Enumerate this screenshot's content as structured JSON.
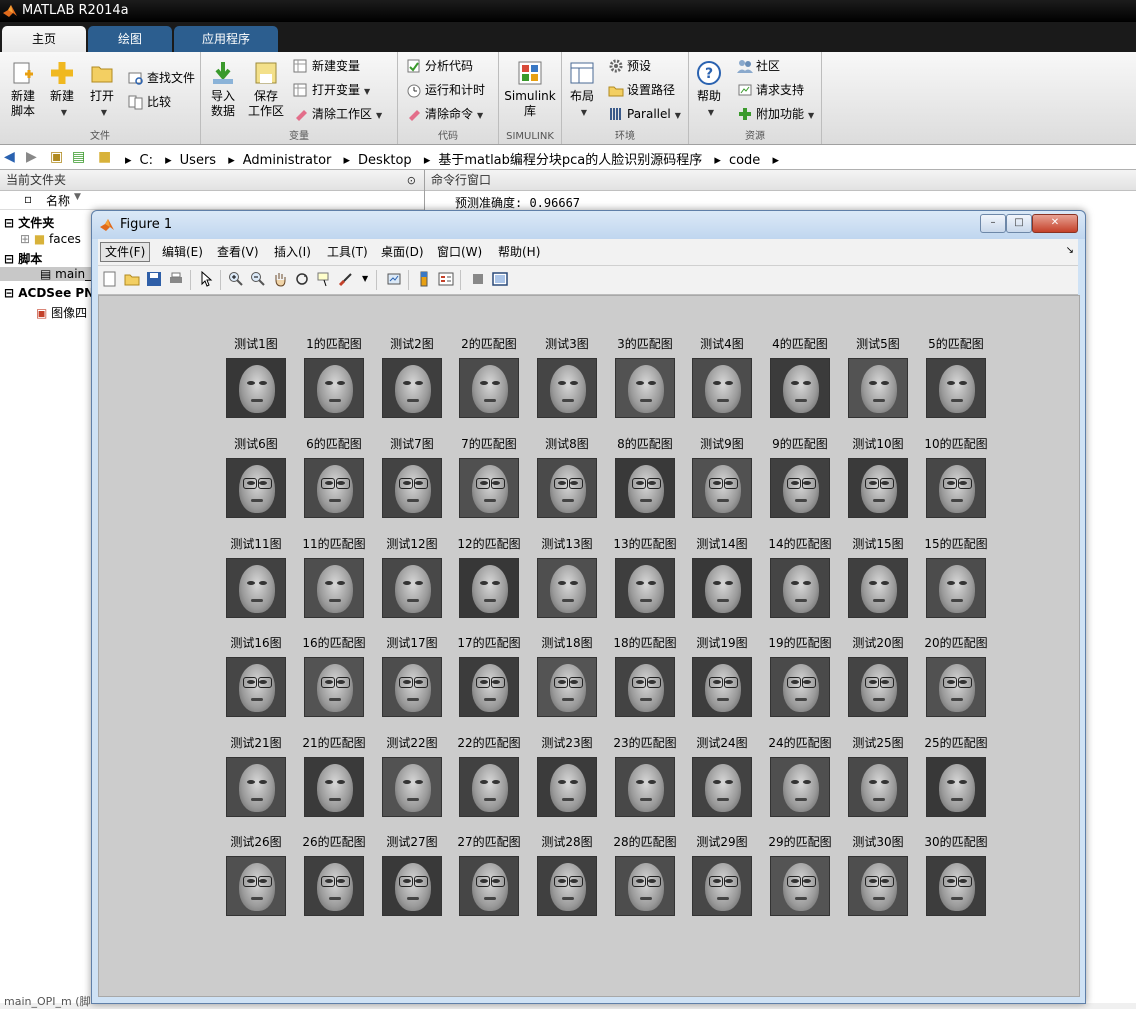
{
  "window": {
    "title": "MATLAB R2014a"
  },
  "tabs": [
    {
      "label": "主页",
      "active": true
    },
    {
      "label": "绘图",
      "active": false
    },
    {
      "label": "应用程序",
      "active": false
    }
  ],
  "ribbon": {
    "file": {
      "label": "文件",
      "new_script": [
        "新建",
        "脚本"
      ],
      "new": "新建",
      "open": "打开",
      "find_files": "查找文件",
      "compare": "比较"
    },
    "variable": {
      "label": "变量",
      "import": [
        "导入",
        "数据"
      ],
      "save": [
        "保存",
        "工作区"
      ],
      "new_var": "新建变量",
      "open_var": "打开变量",
      "clear_ws": "清除工作区"
    },
    "code": {
      "label": "代码",
      "analyze": "分析代码",
      "run_time": "运行和计时",
      "clear_cmd": "清除命令"
    },
    "simulink": {
      "label": "SIMULINK",
      "lib": [
        "Simulink",
        "库"
      ]
    },
    "env": {
      "label": "环境",
      "layout": "布局",
      "prefs": "预设",
      "set_path": "设置路径",
      "parallel": "Parallel"
    },
    "resources": {
      "label": "资源",
      "help": "帮助",
      "community": "社区",
      "request": "请求支持",
      "addons": "附加功能"
    }
  },
  "address": {
    "crumbs": [
      "C:",
      "Users",
      "Administrator",
      "Desktop",
      "基于matlab编程分块pca的人脸识别源码程序",
      "code"
    ]
  },
  "current_folder": {
    "title": "当前文件夹",
    "name_col": "名称",
    "groups": [
      {
        "label": "文件夹",
        "item": "faces"
      },
      {
        "label": "脚本",
        "item": "main_"
      },
      {
        "label": "ACDSee PN",
        "item": "图像四"
      }
    ],
    "status": "main_OPI_m (脚"
  },
  "command_window": {
    "title": "命令行窗口",
    "output": "预测准确度: 0.96667"
  },
  "figure": {
    "title": "Figure 1",
    "menu": [
      "文件(F)",
      "编辑(E)",
      "查看(V)",
      "插入(I)",
      "工具(T)",
      "桌面(D)",
      "窗口(W)",
      "帮助(H)"
    ],
    "pairs": [
      {
        "test": "测试1图",
        "match": "1的匹配图"
      },
      {
        "test": "测试2图",
        "match": "2的匹配图"
      },
      {
        "test": "测试3图",
        "match": "3的匹配图"
      },
      {
        "test": "测试4图",
        "match": "4的匹配图"
      },
      {
        "test": "测试5图",
        "match": "5的匹配图"
      },
      {
        "test": "测试6图",
        "match": "6的匹配图"
      },
      {
        "test": "测试7图",
        "match": "7的匹配图"
      },
      {
        "test": "测试8图",
        "match": "8的匹配图"
      },
      {
        "test": "测试9图",
        "match": "9的匹配图"
      },
      {
        "test": "测试10图",
        "match": "10的匹配图"
      },
      {
        "test": "测试11图",
        "match": "11的匹配图"
      },
      {
        "test": "测试12图",
        "match": "12的匹配图"
      },
      {
        "test": "测试13图",
        "match": "13的匹配图"
      },
      {
        "test": "测试14图",
        "match": "14的匹配图"
      },
      {
        "test": "测试15图",
        "match": "15的匹配图"
      },
      {
        "test": "测试16图",
        "match": "16的匹配图"
      },
      {
        "test": "测试17图",
        "match": "17的匹配图"
      },
      {
        "test": "测试18图",
        "match": "18的匹配图"
      },
      {
        "test": "测试19图",
        "match": "19的匹配图"
      },
      {
        "test": "测试20图",
        "match": "20的匹配图"
      },
      {
        "test": "测试21图",
        "match": "21的匹配图"
      },
      {
        "test": "测试22图",
        "match": "22的匹配图"
      },
      {
        "test": "测试23图",
        "match": "23的匹配图"
      },
      {
        "test": "测试24图",
        "match": "24的匹配图"
      },
      {
        "test": "测试25图",
        "match": "25的匹配图"
      },
      {
        "test": "测试26图",
        "match": "26的匹配图"
      },
      {
        "test": "测试27图",
        "match": "27的匹配图"
      },
      {
        "test": "测试28图",
        "match": "28的匹配图"
      },
      {
        "test": "测试29图",
        "match": "29的匹配图"
      },
      {
        "test": "测试30图",
        "match": "30的匹配图"
      }
    ]
  }
}
